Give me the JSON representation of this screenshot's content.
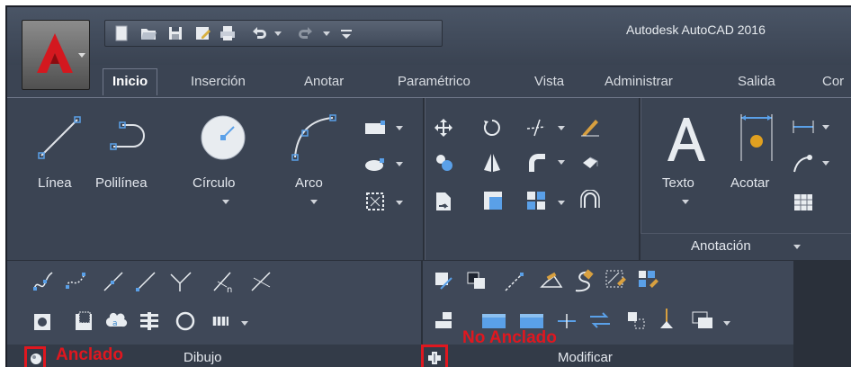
{
  "window": {
    "title": "Autodesk AutoCAD 2016"
  },
  "quick_access": {
    "icons": [
      "new-file-icon",
      "open-folder-icon",
      "save-icon",
      "save-as-icon",
      "print-icon",
      "undo-icon",
      "redo-icon",
      "customize-icon"
    ]
  },
  "ribbon": {
    "tabs": [
      {
        "label": "Inicio",
        "active": true
      },
      {
        "label": "Inserción"
      },
      {
        "label": "Anotar"
      },
      {
        "label": "Paramétrico"
      },
      {
        "label": "Vista"
      },
      {
        "label": "Administrar"
      },
      {
        "label": "Salida"
      },
      {
        "label": "Cor"
      }
    ],
    "draw_panel": {
      "tools": {
        "line": "Línea",
        "polyline": "Polilínea",
        "circle": "Círculo",
        "arc": "Arco"
      },
      "title": "Dibujo"
    },
    "modify_panel": {
      "title": "Modificar"
    },
    "annotation_panel": {
      "tools": {
        "text": "Texto",
        "dimension": "Acotar"
      },
      "title": "Anotación"
    }
  },
  "overlays": {
    "docked_label": "Anclado",
    "undocked_label": "No Anclado"
  },
  "colors": {
    "accent_red": "#e0171f",
    "ribbon_bg": "#3b4453",
    "logo_red": "#d4181f"
  }
}
